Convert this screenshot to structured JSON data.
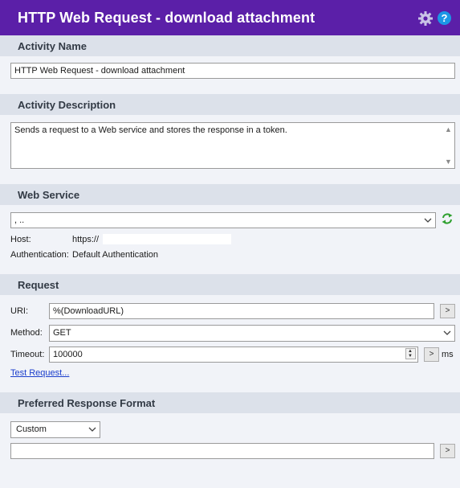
{
  "header": {
    "title": "HTTP Web Request - download attachment",
    "help_label": "?"
  },
  "activity_name": {
    "section_label": "Activity Name",
    "value": "HTTP Web Request - download attachment"
  },
  "activity_description": {
    "section_label": "Activity Description",
    "value": "Sends a request to a Web service and stores the response in a token."
  },
  "web_service": {
    "section_label": "Web Service",
    "selected_value": ", ..",
    "host_label": "Host:",
    "host_value": "https://",
    "auth_label": "Authentication:",
    "auth_value": "Default Authentication"
  },
  "request": {
    "section_label": "Request",
    "uri_label": "URI:",
    "uri_value": "%(DownloadURL)",
    "method_label": "Method:",
    "method_value": "GET",
    "timeout_label": "Timeout:",
    "timeout_value": "100000",
    "timeout_unit": "ms",
    "test_link": "Test Request...",
    "expand_label": ">"
  },
  "response_format": {
    "section_label": "Preferred Response Format",
    "selected_value": "Custom",
    "custom_value": "",
    "expand_label": ">"
  },
  "colors": {
    "titlebar": "#5b1fa8",
    "section_header": "#dce1ea",
    "panel_background": "#f1f3f8",
    "link": "#1a3dcc",
    "help_icon": "#1c97e6",
    "refresh_icon": "#2ea02e"
  },
  "icons": [
    "gear-icon",
    "help-icon",
    "refresh-icon",
    "chevron-down-icon",
    "scroll-up-icon",
    "scroll-down-icon",
    "spin-up-icon",
    "spin-down-icon"
  ]
}
